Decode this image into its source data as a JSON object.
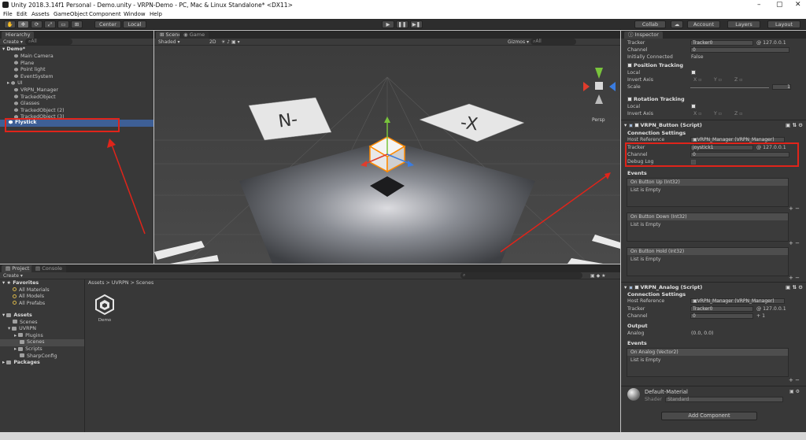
{
  "window": {
    "title": "Unity 2018.3.14f1 Personal - Demo.unity - VRPN-Demo - PC, Mac & Linux Standalone* <DX11>"
  },
  "menu": [
    "File",
    "Edit",
    "Assets",
    "GameObject",
    "Component",
    "Window",
    "Help"
  ],
  "toolbar": {
    "pivot": "Center",
    "space": "Local",
    "collab": "Collab",
    "account": "Account",
    "layers": "Layers",
    "layout": "Layout"
  },
  "hierarchy": {
    "tab": "Hierarchy",
    "create": "Create",
    "search_prefix": "All",
    "scene": "Demo*",
    "items": [
      "Main Camera",
      "Plane",
      "Point light",
      "EventSystem",
      "UI",
      "VRPN_Manager",
      "TrackedObject",
      "Glasses",
      "TrackedObject (2)",
      "TrackedObject (3)",
      "Flystick"
    ]
  },
  "scene": {
    "tab_scene": "Scene",
    "tab_game": "Game",
    "shading": "Shaded",
    "mode2d": "2D",
    "gizmos": "Gizmos",
    "search_prefix": "All",
    "persp": "Persp",
    "label_n": "N-",
    "label_x": "-X"
  },
  "project": {
    "tab_project": "Project",
    "tab_console": "Console",
    "create": "Create",
    "favorites": "Favorites",
    "fav_items": [
      "All Materials",
      "All Models",
      "All Prefabs"
    ],
    "assets": "Assets",
    "tree": [
      "Scenes",
      "UVRPN",
      "Plugins",
      "Scenes",
      "Scripts",
      "SharpConfig"
    ],
    "packages": "Packages",
    "breadcrumb": "Assets > UVRPN > Scenes",
    "file": "Demo"
  },
  "inspector": {
    "tab": "Inspector",
    "tracker_label": "Tracker",
    "tracker_value": "Tracker0",
    "tracker_host": "@ 127.0.0.1",
    "channel_label": "Channel",
    "channel_value": "0",
    "init_label": "Initially Connected",
    "init_value": "False",
    "pos_tracking": "Position Tracking",
    "local_label": "Local",
    "invert_label": "Invert Axis",
    "x": "X",
    "y": "Y",
    "z": "Z",
    "scale_label": "Scale",
    "scale_value": "1",
    "rot_tracking": "Rotation Tracking",
    "local2_label": "Local",
    "invert2_label": "Invert Axis",
    "button_comp": "VRPN_Button (Script)",
    "conn_settings": "Connection Settings",
    "host_ref_label": "Host Reference",
    "host_ref_value": "VRPN_Manager (VRPN_Manager)",
    "btn_tracker_label": "Tracker",
    "btn_tracker_value": "joystick1",
    "btn_tracker_host": "@ 127.0.0.1",
    "btn_channel_label": "Channel",
    "btn_channel_value": "0",
    "debug_label": "Debug Log",
    "events": "Events",
    "on_up": "On Button Up (Int32)",
    "on_down": "On Button Down (Int32)",
    "on_hold": "On Button Hold (Int32)",
    "list_empty": "List is Empty",
    "analog_comp": "VRPN_Analog (Script)",
    "conn_settings2": "Connection Settings",
    "host_ref_label2": "Host Reference",
    "host_ref_value2": "VRPN_Manager (VRPN_Manager)",
    "an_tracker_label": "Tracker",
    "an_tracker_value": "Tracker0",
    "an_tracker_host": "@ 127.0.0.1",
    "an_channel_label": "Channel",
    "an_channel_value": "0",
    "an_channel_suffix": "+ 1",
    "output": "Output",
    "analog_label": "Analog",
    "analog_value": "(0.0, 0.0)",
    "events2": "Events",
    "on_analog": "On Analog (Vector2)",
    "material_name": "Default-Material",
    "shader_label": "Shader",
    "shader_value": "Standard",
    "add_component": "Add Component"
  },
  "colors": {
    "accent_selection": "#3e5f96",
    "annotation_red": "#e0241a"
  }
}
